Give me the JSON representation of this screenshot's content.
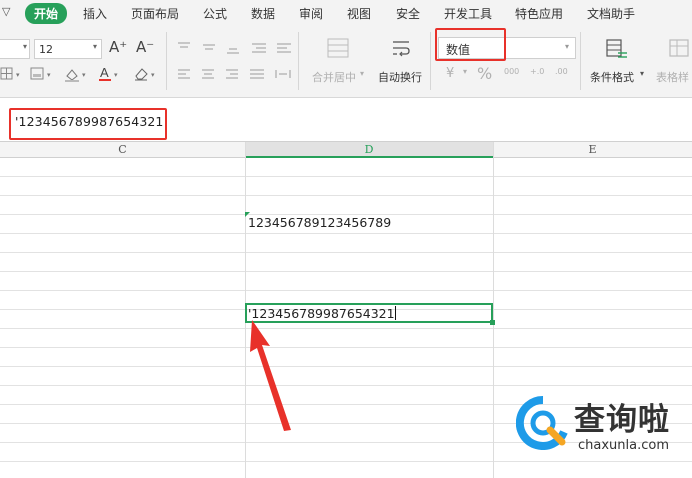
{
  "menu": {
    "chevron": "▽",
    "items": [
      "开始",
      "插入",
      "页面布局",
      "公式",
      "数据",
      "审阅",
      "视图",
      "安全",
      "开发工具",
      "特色应用",
      "文档助手"
    ]
  },
  "ribbon": {
    "font_size": "12",
    "increase_font_glyph": "A⁺",
    "decrease_font_glyph": "A⁻",
    "merge_center_label": "合并居中",
    "wrap_text_label": "自动换行",
    "number_format": "数值",
    "number_format_icons": [
      "¥",
      "%",
      "000",
      "+.0",
      ".00"
    ],
    "conditional_format_label": "条件格式",
    "table_style_label": "表格样"
  },
  "formula_bar": {
    "value": "'123456789987654321"
  },
  "columns": [
    "C",
    "D",
    "E"
  ],
  "cells": {
    "d_row4": "123456789123456789",
    "d_row9": "'123456789987654321"
  },
  "colors": {
    "accent": "#27a05a",
    "highlight": "#e8312a",
    "watermark_blue": "#1e9be8"
  },
  "watermark": {
    "brand": "查询啦",
    "url": "chaxunla.com"
  }
}
